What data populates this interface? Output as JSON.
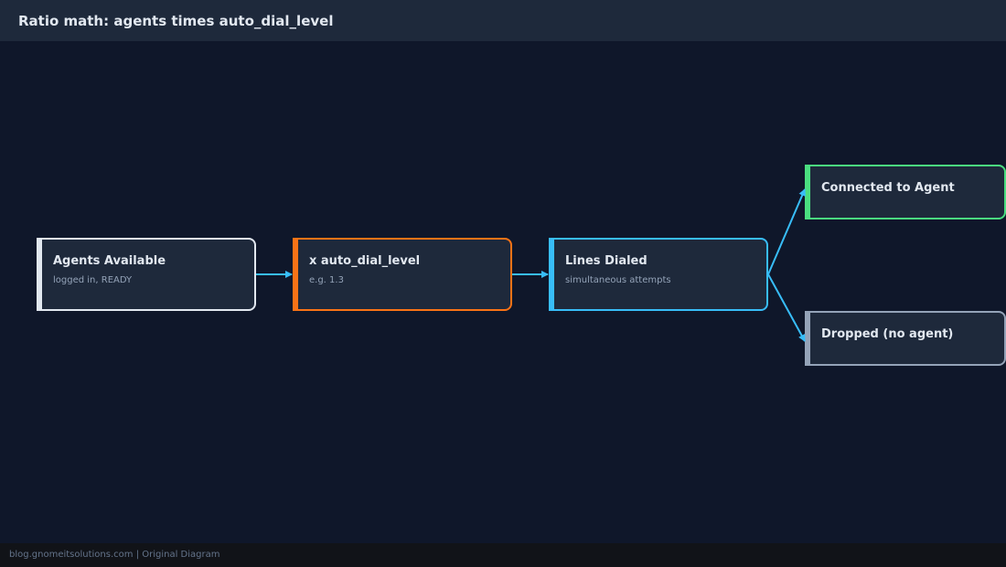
{
  "header": {
    "title": "Ratio math: agents times auto_dial_level"
  },
  "diagram": {
    "nodes": [
      {
        "id": "agents",
        "title": "Agents Available",
        "subtitle": "logged in, READY",
        "color": "#e2e8f0"
      },
      {
        "id": "dial_level",
        "title": "x auto_dial_level",
        "subtitle": "e.g. 1.3",
        "color": "#f97316"
      },
      {
        "id": "lines",
        "title": "Lines Dialed",
        "subtitle": "simultaneous attempts",
        "color": "#38bdf8"
      },
      {
        "id": "connected",
        "title": "Connected to Agent",
        "subtitle": "",
        "color": "#4ade80"
      },
      {
        "id": "dropped",
        "title": "Dropped (no agent)",
        "subtitle": "",
        "color": "#94a3b8"
      }
    ],
    "edges": [
      {
        "from": "agents",
        "to": "dial_level"
      },
      {
        "from": "dial_level",
        "to": "lines"
      },
      {
        "from": "lines",
        "to": "connected"
      },
      {
        "from": "lines",
        "to": "dropped"
      }
    ],
    "edge_color": "#38bdf8"
  },
  "footer": {
    "text": "blog.gnomeitsolutions.com | Original Diagram"
  }
}
